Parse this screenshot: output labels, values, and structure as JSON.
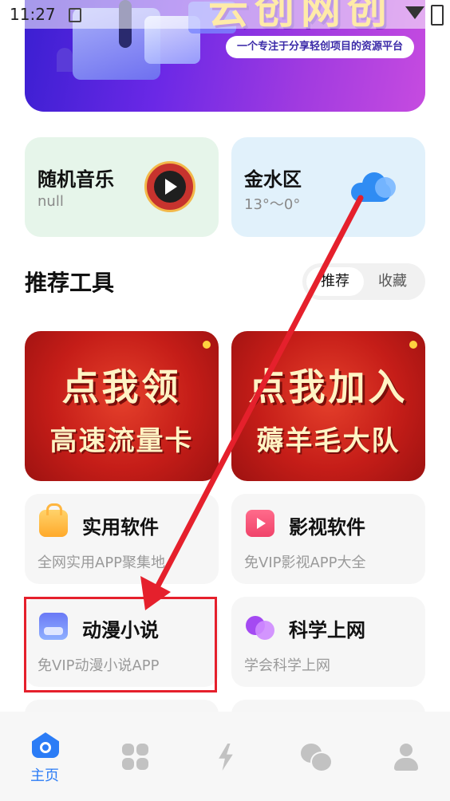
{
  "status_bar": {
    "time": "11:27"
  },
  "banner": {
    "title": "云创网创",
    "tagline": "一个专注于分享轻创项目的资源平台"
  },
  "music_card": {
    "title": "随机音乐",
    "subtitle": "null"
  },
  "weather_card": {
    "location": "金水区",
    "temperature": "13°～0°"
  },
  "section": {
    "title": "推荐工具",
    "tabs": [
      {
        "label": "推荐",
        "active": true
      },
      {
        "label": "收藏",
        "active": false
      }
    ]
  },
  "promos": [
    {
      "line1": "点我领",
      "line2": "高速流量卡"
    },
    {
      "line1": "点我加入",
      "line2": "薅羊毛大队"
    }
  ],
  "tools": [
    {
      "name": "实用软件",
      "desc": "全网实用APP聚集地",
      "icon": "shopping-bag-icon"
    },
    {
      "name": "影视软件",
      "desc": "免VIP影视APP大全",
      "icon": "video-icon"
    },
    {
      "name": "动漫小说",
      "desc": "免VIP动漫小说APP",
      "icon": "picture-icon"
    },
    {
      "name": "科学上网",
      "desc": "学会科学上网",
      "icon": "bubbles-icon"
    }
  ],
  "bottom_nav": [
    {
      "label": "主页",
      "icon": "home-icon",
      "active": true
    },
    {
      "label": "",
      "icon": "grid-icon",
      "active": false
    },
    {
      "label": "",
      "icon": "lightning-icon",
      "active": false
    },
    {
      "label": "",
      "icon": "chat-icon",
      "active": false
    },
    {
      "label": "",
      "icon": "user-icon",
      "active": false
    }
  ],
  "colors": {
    "accent": "#2b7cf6",
    "annotation": "#e5202c",
    "music_card_bg": "#e6f5ea",
    "weather_card_bg": "#e1f1fb"
  }
}
